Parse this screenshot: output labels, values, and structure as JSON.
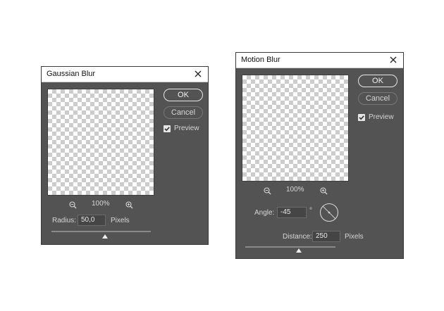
{
  "gaussian": {
    "title": "Gaussian Blur",
    "ok_label": "OK",
    "cancel_label": "Cancel",
    "preview_label": "Preview",
    "preview_checked": true,
    "zoom": "100%",
    "radius_label": "Radius:",
    "radius_value": "50,0",
    "radius_unit": "Pixels"
  },
  "motion": {
    "title": "Motion Blur",
    "ok_label": "OK",
    "cancel_label": "Cancel",
    "preview_label": "Preview",
    "preview_checked": true,
    "zoom": "100%",
    "angle_label": "Angle:",
    "angle_value": "-45",
    "angle_unit": "°",
    "distance_label": "Distance:",
    "distance_value": "250",
    "distance_unit": "Pixels"
  },
  "icons": {
    "close": "close-icon",
    "zoom_out": "zoom-out-icon",
    "zoom_in": "zoom-in-icon",
    "checkbox": "checkmark-icon",
    "angle_dial": "angle-dial-icon"
  },
  "colors": {
    "panel": "#535353",
    "titlebar": "#ffffff",
    "text": "#d6d6d6"
  }
}
